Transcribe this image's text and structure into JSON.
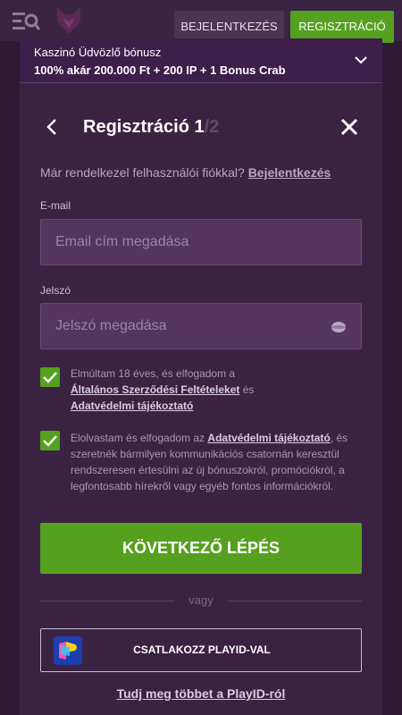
{
  "header": {
    "login_label": "BEJELENTKEZÉS",
    "register_label": "REGISZTRÁCIÓ"
  },
  "bonus": {
    "title": "Kaszinó Üdvözlő bónusz",
    "text": "100% akár 200.000 Ft + 200 IP + 1 Bonus Crab"
  },
  "form": {
    "title": "Regisztráció 1",
    "step_total": "/2",
    "have_account": "Már rendelkezel felhasználói fiókkal?",
    "login_link": "Bejelentkezés",
    "email_label": "E-mail",
    "email_placeholder": "Email cím megadása",
    "email_value": "",
    "password_label": "Jelszó",
    "password_placeholder": "Jelszó megadása",
    "password_value": "",
    "consent1": {
      "checked": true,
      "text_a": "Elmúltam 18 éves, és elfogadom a",
      "link_a": "Általános Szerződési Feltételeket",
      "text_b": "és",
      "link_b": "Adatvédelmi tájékoztató"
    },
    "consent2": {
      "checked": true,
      "text_a": "Elolvastam és elfogadom az",
      "link_a": "Adatvédelmi tájékoztató",
      "text_b": ", és szeretnék bármilyen kommunikációs csatornán keresztül rendszeresen értesülni az új bónuszokról, promóciókról, a legfontosabb hírekről vagy egyéb fontos információkról."
    },
    "next_label": "KÖVETKEZŐ LÉPÉS",
    "divider_label": "vagy",
    "playid_label": "CSATLAKOZZ PLAYID-VAL",
    "learn_more": "Tudj meg többet a PlayID-ról"
  },
  "colors": {
    "accent_green": "#56a020",
    "background": "#2c1b33",
    "panel": "#3a2342"
  },
  "icons": {
    "menu": "menu-search-icon",
    "logo": "fox-logo-icon",
    "chevron": "chevron-down-icon",
    "back": "chevron-left-icon",
    "close": "close-icon",
    "eye": "eye-icon",
    "check": "check-icon",
    "playid": "playid-logo-icon"
  }
}
